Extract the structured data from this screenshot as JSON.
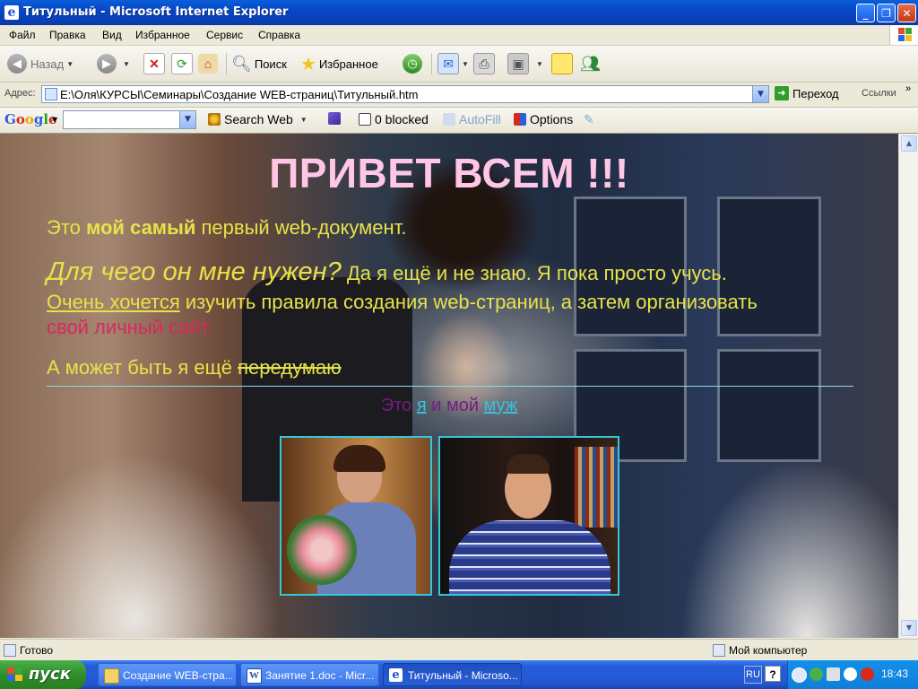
{
  "window": {
    "title": "Титульный - Microsoft Internet Explorer"
  },
  "menu": [
    "Файл",
    "Правка",
    "Вид",
    "Избранное",
    "Сервис",
    "Справка"
  ],
  "toolbar": {
    "back": "Назад",
    "search": "Поиск",
    "favorites": "Избранное"
  },
  "address": {
    "label": "Адрес:",
    "url": "E:\\Оля\\КУРСЫ\\Семинары\\Создание WEB-страниц\\Титульный.htm",
    "go": "Переход",
    "links": "Ссылки",
    "more": "»"
  },
  "google": {
    "logo": "Google",
    "search_web": "Search Web",
    "blocked": "0 blocked",
    "autofill": "AutoFill",
    "options": "Options"
  },
  "page": {
    "headline": "ПРИВЕТ ВСЕМ !!!",
    "p1_a": "Это ",
    "p1_b": "мой самый",
    "p1_c": " первый web-документ.",
    "p2_q": "Для чего он мне нужен?",
    "p2_a": " Да я ещё и не знаю. Я пока просто учусь.",
    "p3_u": "Очень хочется",
    "p3_b": " изучить правила создания web-страниц, а затем организовать",
    "p3_pink": "свой личный сайт.",
    "p4_a": "А может быть я ещё ",
    "p4_s": "передумаю",
    "caption_a": "Это ",
    "caption_me": "я",
    "caption_b": " и мой ",
    "caption_husband": "муж"
  },
  "status": {
    "text": "Готово",
    "zone": "Мой компьютер"
  },
  "taskbar": {
    "start": "пуск",
    "tasks": [
      "Создание WEB-стра...",
      "Занятие 1.doc - Micr...",
      "Титульный - Microso..."
    ],
    "lang": "RU",
    "clock": "18:43"
  },
  "colors": {
    "headline": "#ffc6e6",
    "body_text": "#e7e24a",
    "pink_text": "#d9285d",
    "caption": "#7a1a80",
    "link_cyan": "#3ac0e0"
  }
}
